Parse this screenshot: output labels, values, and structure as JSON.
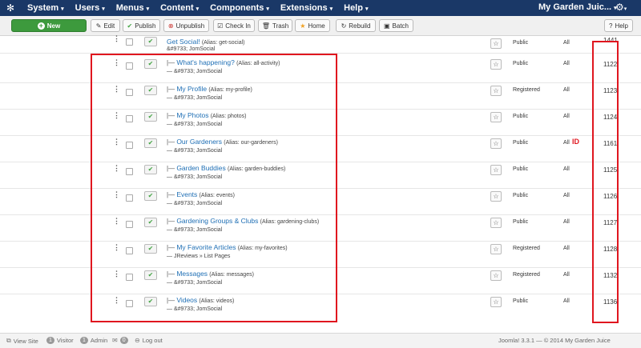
{
  "topnav": {
    "menus": [
      "System",
      "Users",
      "Menus",
      "Content",
      "Components",
      "Extensions",
      "Help"
    ],
    "site_name": "My Garden Juic..."
  },
  "toolbar": {
    "new": "New",
    "edit": "Edit",
    "publish": "Publish",
    "unpublish": "Unpublish",
    "checkin": "Check In",
    "trash": "Trash",
    "home": "Home",
    "rebuild": "Rebuild",
    "batch": "Batch",
    "help": "Help"
  },
  "rows": [
    {
      "dash": "",
      "title": "Get Social!",
      "alias": "(Alias: get-social)",
      "sub": "&#9733; JomSocial",
      "access": "Public",
      "lang": "All",
      "id": "1441"
    },
    {
      "dash": "|— ",
      "title": "What's happening?",
      "alias": "(Alias: all-activity)",
      "sub": "— &#9733; JomSocial",
      "access": "Public",
      "lang": "All",
      "id": "1122"
    },
    {
      "dash": "|— ",
      "title": "My Profile",
      "alias": "(Alias: my-profile)",
      "sub": "— &#9733; JomSocial",
      "access": "Registered",
      "lang": "All",
      "id": "1123"
    },
    {
      "dash": "|— ",
      "title": "My Photos",
      "alias": "(Alias: photos)",
      "sub": "— &#9733; JomSocial",
      "access": "Public",
      "lang": "All",
      "id": "1124"
    },
    {
      "dash": "|— ",
      "title": "Our Gardeners",
      "alias": "(Alias: our-gardeners)",
      "sub": "— &#9733; JomSocial",
      "access": "Public",
      "lang": "All",
      "id": "1161"
    },
    {
      "dash": "|— ",
      "title": "Garden Buddies",
      "alias": "(Alias: garden-buddies)",
      "sub": "— &#9733; JomSocial",
      "access": "Public",
      "lang": "All",
      "id": "1125"
    },
    {
      "dash": "|— ",
      "title": "Events",
      "alias": "(Alias: events)",
      "sub": "— &#9733; JomSocial",
      "access": "Public",
      "lang": "All",
      "id": "1126"
    },
    {
      "dash": "|— ",
      "title": "Gardening Groups & Clubs",
      "alias": "(Alias: gardening-clubs)",
      "sub": "— &#9733; JomSocial",
      "access": "Public",
      "lang": "All",
      "id": "1127"
    },
    {
      "dash": "|— ",
      "title": "My Favorite Articles",
      "alias": "(Alias: my-favorites)",
      "sub": "— JReviews » List Pages",
      "access": "Registered",
      "lang": "All",
      "id": "1128"
    },
    {
      "dash": "|— ",
      "title": "Messages",
      "alias": "(Alias: messages)",
      "sub": "— &#9733; JomSocial",
      "access": "Registered",
      "lang": "All",
      "id": "1132"
    },
    {
      "dash": "|— ",
      "title": "Videos",
      "alias": "(Alias: videos)",
      "sub": "— &#9733; JomSocial",
      "access": "Public",
      "lang": "All",
      "id": "1136"
    }
  ],
  "annotation": {
    "id_marker": "ID",
    "color": "#e0161f"
  },
  "footer": {
    "view_site": "View Site",
    "visitors_count": "1",
    "visitors_label": "Visitor",
    "admins_count": "1",
    "admins_label": "Admin",
    "messages_count": "0",
    "logout": "Log out",
    "version": "Joomla! 3.3.1  —  © 2014 My Garden Juice"
  }
}
